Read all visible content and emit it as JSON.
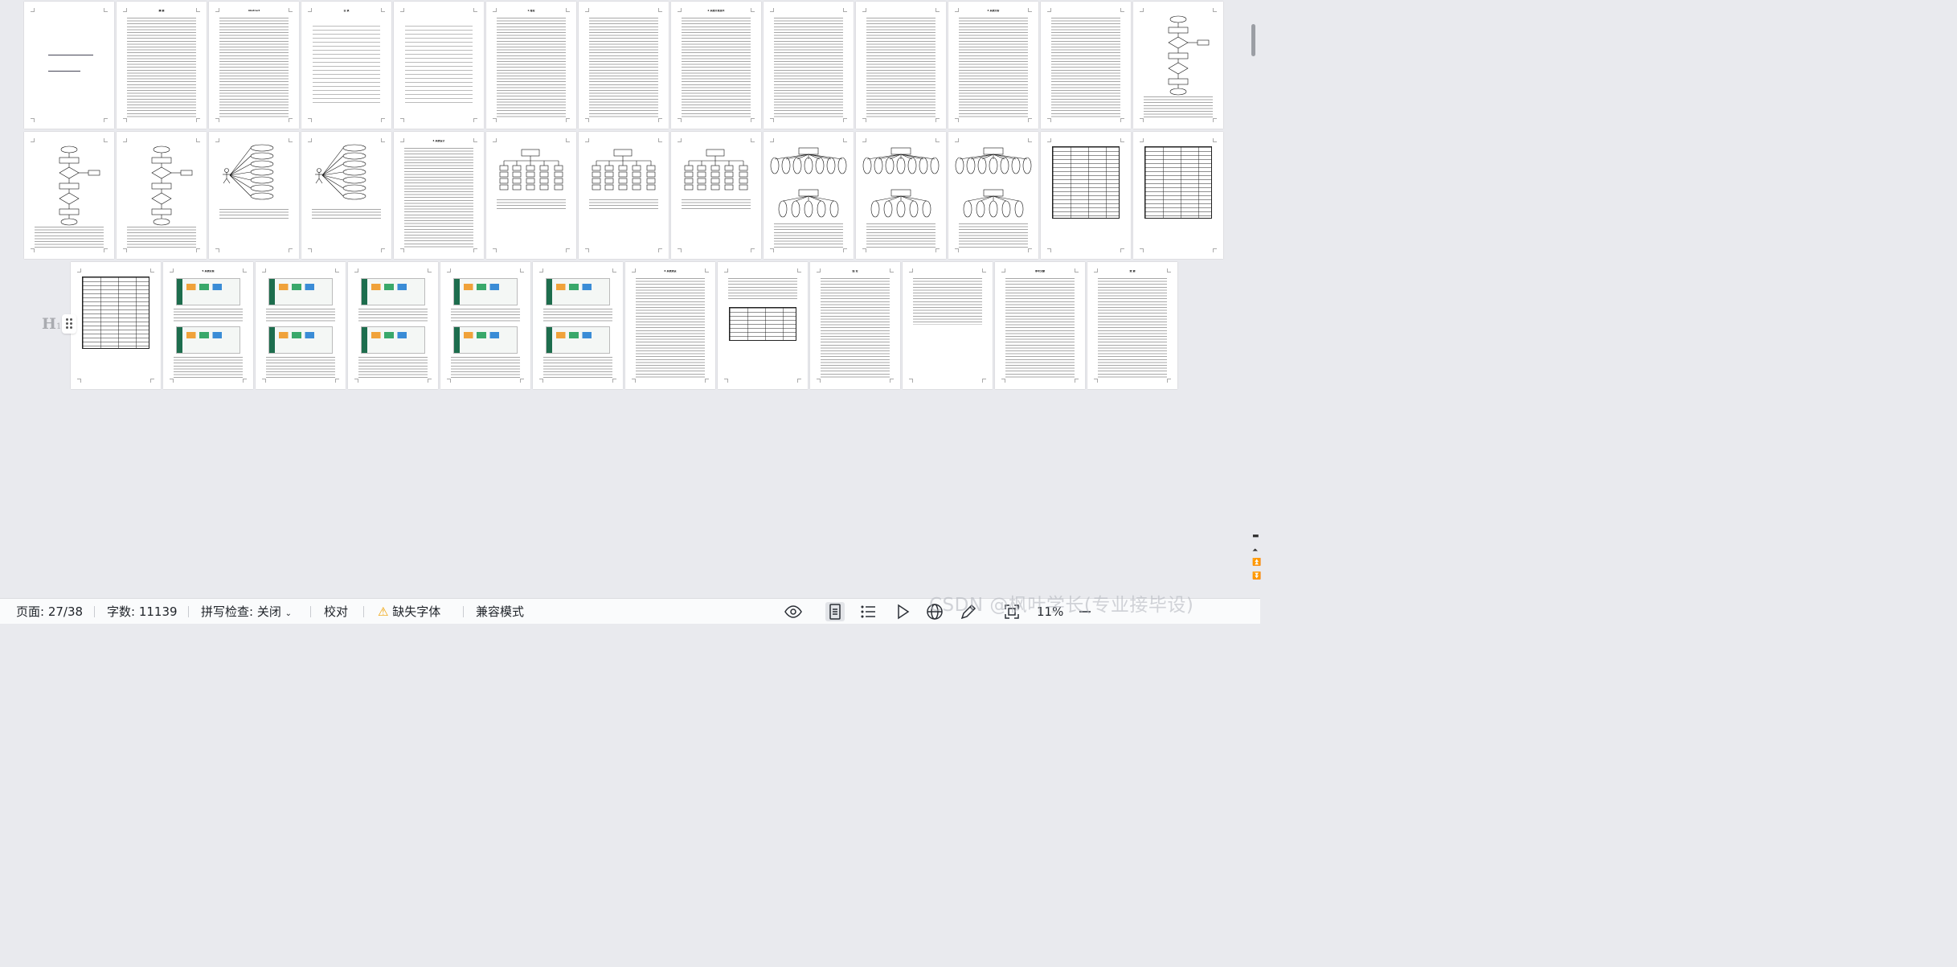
{
  "document": {
    "pages": [
      {
        "kind": "cover"
      },
      {
        "kind": "text",
        "title": "摘 要"
      },
      {
        "kind": "text",
        "title": "Abstract"
      },
      {
        "kind": "toc",
        "title": "目 录"
      },
      {
        "kind": "toc",
        "title": ""
      },
      {
        "kind": "text",
        "title": "1 绪论"
      },
      {
        "kind": "text",
        "title": ""
      },
      {
        "kind": "text",
        "title": "2 系统开发技术"
      },
      {
        "kind": "text",
        "title": ""
      },
      {
        "kind": "text",
        "title": ""
      },
      {
        "kind": "text",
        "title": "3 系统分析"
      },
      {
        "kind": "text",
        "title": ""
      },
      {
        "kind": "flow",
        "title": ""
      },
      {
        "kind": "flow",
        "title": ""
      },
      {
        "kind": "flow",
        "title": ""
      },
      {
        "kind": "usecase",
        "title": ""
      },
      {
        "kind": "usecase",
        "title": ""
      },
      {
        "kind": "text",
        "title": "4 系统设计"
      },
      {
        "kind": "tree",
        "title": ""
      },
      {
        "kind": "tree",
        "title": ""
      },
      {
        "kind": "tree",
        "title": ""
      },
      {
        "kind": "er",
        "title": ""
      },
      {
        "kind": "er",
        "title": ""
      },
      {
        "kind": "er",
        "title": ""
      },
      {
        "kind": "table",
        "title": ""
      },
      {
        "kind": "table",
        "title": ""
      },
      {
        "kind": "table",
        "title": ""
      },
      {
        "kind": "screens",
        "title": "5 系统实现"
      },
      {
        "kind": "screens",
        "title": ""
      },
      {
        "kind": "screens",
        "title": ""
      },
      {
        "kind": "screens",
        "title": ""
      },
      {
        "kind": "screens",
        "title": ""
      },
      {
        "kind": "text",
        "title": "6 系统测试"
      },
      {
        "kind": "testtable",
        "title": ""
      },
      {
        "kind": "text",
        "title": "结 论"
      },
      {
        "kind": "textshort",
        "title": ""
      },
      {
        "kind": "text",
        "title": "参考文献"
      },
      {
        "kind": "text",
        "title": "致 谢"
      }
    ]
  },
  "left_gutter": {
    "heading_mark": "H",
    "heading_level": "1"
  },
  "statusbar": {
    "page": "页面: 27/38",
    "wordcount": "字数: 11139",
    "spellcheck": "拼写检查: 关闭",
    "proofread": "校对",
    "missing_fonts": "缺失字体",
    "compat_mode": "兼容模式",
    "zoom": "11%",
    "icons": [
      "eye-icon",
      "page-view-icon",
      "outline-view-icon",
      "play-icon",
      "web-globe-icon",
      "pen-icon",
      "fit-page-icon",
      "zoom-out-icon"
    ]
  },
  "watermark": "CSDN @枫叶学长(专业接毕设)",
  "colors": {
    "accent_green": "#1d6d4d",
    "warning": "#f0a000",
    "canvas": "#e9eaee"
  }
}
